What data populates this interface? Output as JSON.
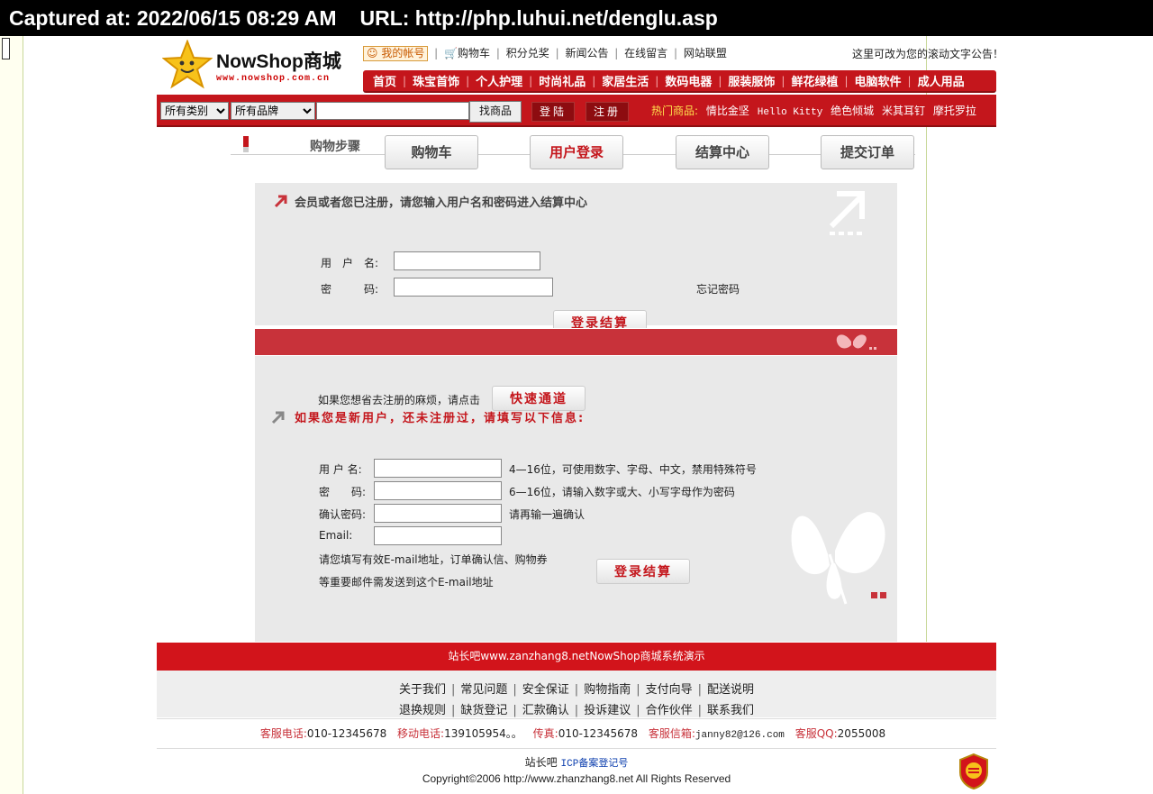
{
  "capture": {
    "captured_at": "Captured at: 2022/06/15 08:29 AM",
    "url": "URL: http://php.luhui.net/denglu.asp"
  },
  "header": {
    "brand": "NowShop商城",
    "brand_url": "www.nowshop.com.cn",
    "account_link": "我的帐号",
    "top_links": [
      "购物车",
      "积分兑奖",
      "新闻公告",
      "在线留言",
      "网站联盟"
    ],
    "marquee": "这里可改为您的滚动文字公告！",
    "categories": [
      "首页",
      "珠宝首饰",
      "个人护理",
      "时尚礼品",
      "家居生活",
      "数码电器",
      "服装服饰",
      "鲜花绿植",
      "电脑软件",
      "成人用品"
    ]
  },
  "search": {
    "category_select": "所有类别",
    "brand_select": "所有品牌",
    "keyword": "",
    "find_button": "找商品",
    "login_button": "登陆",
    "register_button": "注册",
    "hot_label": "热门商品:",
    "hot_items": [
      "情比金坚",
      "Hello Kitty",
      "绝色倾城",
      "米其耳钉",
      "摩托罗拉"
    ]
  },
  "steps": {
    "title": "购物步骤",
    "items": [
      "购物车",
      "用户登录",
      "结算中心",
      "提交订单"
    ],
    "active_index": 1
  },
  "login": {
    "heading": "会员或者您已注册，请您输入用户名和密码进入结算中心",
    "username_label": "用　户　名:",
    "password_label": "密　　　码:",
    "submit": "登录结算",
    "forgot": "忘记密码"
  },
  "quick": {
    "text": "如果您想省去注册的麻烦，请点击",
    "button": "快速通道"
  },
  "register": {
    "heading": "如果您是新用户，还未注册过，请填写以下信息:",
    "fields": [
      {
        "label": "用 户 名:",
        "hint": "4—16位，可使用数字、字母、中文，禁用特殊符号"
      },
      {
        "label": "密　　码:",
        "hint": "6—16位，请输入数字或大、小写字母作为密码"
      },
      {
        "label": "确认密码:",
        "hint": "请再输一遍确认"
      },
      {
        "label": "Email:",
        "hint": ""
      }
    ],
    "note_line1": "请您填写有效E-mail地址，订单确认信、购物券",
    "note_line2": "等重要邮件需发送到这个E-mail地址",
    "submit": "登录结算"
  },
  "footer": {
    "bar_text": "站长吧www.zanzhang8.netNowShop商城系统演示",
    "links_row1": [
      "关于我们",
      "常见问题",
      "安全保证",
      "购物指南",
      "支付向导",
      "配送说明"
    ],
    "links_row2": [
      "退换规则",
      "缺货登记",
      "汇款确认",
      "投诉建议",
      "合作伙伴",
      "联系我们"
    ],
    "contact": [
      {
        "k": "客服电话:",
        "v": "010-12345678"
      },
      {
        "k": "移动电话:",
        "v": "139105954。。"
      },
      {
        "k": "传真:",
        "v": "010-12345678"
      },
      {
        "k": "客服信箱:",
        "v": "janny82@126.com"
      },
      {
        "k": "客服QQ:",
        "v": "2055008"
      }
    ],
    "icp_prefix": "站长吧",
    "icp_link": "ICP备案登记号",
    "copyright": "Copyright©2006 http://www.zhanzhang8.net All Rights Reserved"
  },
  "colors": {
    "brand_red": "#c4161c",
    "band_red": "#c8323a",
    "panel_gray": "#e9e9e9",
    "hot_yellow": "#ffe14d"
  }
}
